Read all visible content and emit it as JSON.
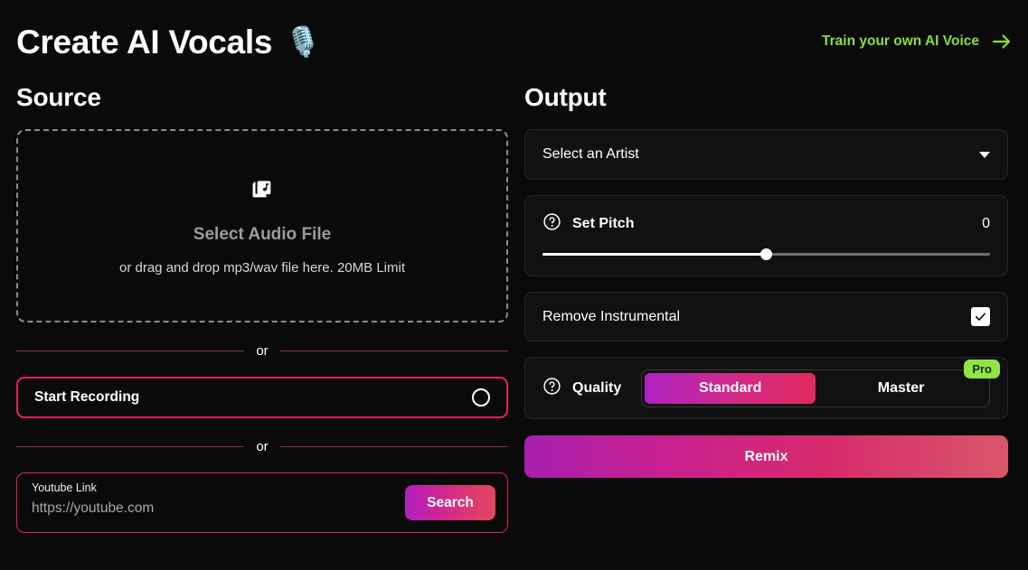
{
  "header": {
    "title": "Create AI Vocals",
    "title_emoji": "🎙️",
    "train_link_label": "Train your own AI Voice",
    "accent_green": "#8ade3a"
  },
  "source": {
    "section_title": "Source",
    "dropzone": {
      "icon": "library-music-icon",
      "primary_label": "Select Audio File",
      "secondary_label": "or drag and drop mp3/wav file here. 20MB Limit"
    },
    "divider_one_label": "or",
    "record": {
      "label": "Start Recording",
      "icon": "record-circle-icon",
      "border_color": "#e4225c"
    },
    "divider_two_label": "or",
    "youtube": {
      "label": "Youtube Link",
      "value": "",
      "placeholder": "https://youtube.com",
      "search_label": "Search"
    }
  },
  "output": {
    "section_title": "Output",
    "artist_select": {
      "value": "Select an Artist",
      "caret_icon": "chevron-down-icon"
    },
    "pitch": {
      "help_icon": "help-circle-icon",
      "label": "Set Pitch",
      "value": "0",
      "slider_percent": 50
    },
    "remove_instrumental": {
      "label": "Remove Instrumental",
      "checked": true,
      "check_icon": "check-icon"
    },
    "quality": {
      "help_icon": "help-circle-icon",
      "label": "Quality",
      "options": [
        {
          "label": "Standard",
          "active": true
        },
        {
          "label": "Master",
          "active": false
        }
      ],
      "pro_badge": "Pro",
      "pro_badge_color": "#92e544"
    },
    "remix_label": "Remix",
    "gradient_start": "#a81fad",
    "gradient_end": "#d9566a"
  }
}
